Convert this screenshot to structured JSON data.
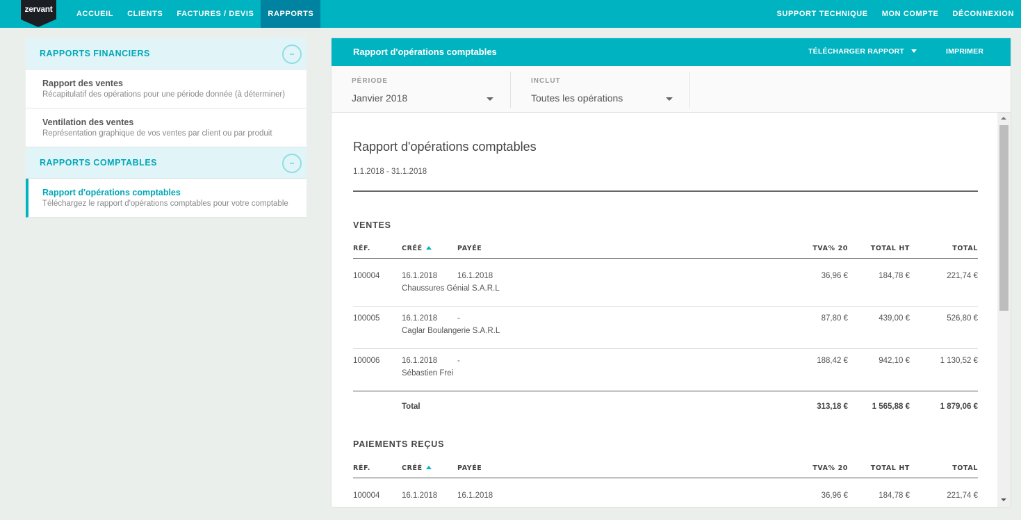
{
  "topnav": {
    "logo": "zervant",
    "left_items": [
      {
        "label": "ACCUEIL",
        "active": false
      },
      {
        "label": "CLIENTS",
        "active": false
      },
      {
        "label": "FACTURES / DEVIS",
        "active": false
      },
      {
        "label": "RAPPORTS",
        "active": true
      }
    ],
    "right_items": [
      {
        "label": "SUPPORT TECHNIQUE"
      },
      {
        "label": "MON COMPTE"
      },
      {
        "label": "DÉCONNEXION"
      }
    ]
  },
  "sidebar": {
    "groups": [
      {
        "title": "RAPPORTS FINANCIERS",
        "collapse_icon": "minus-circle-icon",
        "items": [
          {
            "title": "Rapport des ventes",
            "description": "Récapitulatif des opérations pour une période donnée (à déterminer)",
            "active": false
          },
          {
            "title": "Ventilation des ventes",
            "description": "Représentation graphique de vos ventes par client ou par produit",
            "active": false
          }
        ]
      },
      {
        "title": "RAPPORTS COMPTABLES",
        "collapse_icon": "minus-circle-icon",
        "items": [
          {
            "title": "Rapport d'opérations comptables",
            "description": "Téléchargez le rapport d'opérations comptables pour votre comptable",
            "active": true
          }
        ]
      }
    ]
  },
  "panel": {
    "title": "Rapport d'opérations comptables",
    "download_label": "TÉLÉCHARGER RAPPORT",
    "print_label": "IMPRIMER",
    "filters": {
      "period": {
        "label": "PÉRIODE",
        "value": "Janvier 2018"
      },
      "includes": {
        "label": "INCLUT",
        "value": "Toutes les opérations"
      }
    }
  },
  "report": {
    "title": "Rapport d'opérations comptables",
    "date_range": "1.1.2018 - 31.1.2018",
    "columns": {
      "ref": "RÉF.",
      "created": "CRÉÉ",
      "paid": "PAYÉE",
      "vat": "TVA% 20",
      "total_ht": "TOTAL HT",
      "total": "TOTAL"
    },
    "sales": {
      "title": "VENTES",
      "rows": [
        {
          "ref": "100004",
          "created": "16.1.2018",
          "paid": "16.1.2018",
          "client": "Chaussures Génial S.A.R.L",
          "vat": "36,96 €",
          "total_ht": "184,78 €",
          "total": "221,74 €"
        },
        {
          "ref": "100005",
          "created": "16.1.2018",
          "paid": "-",
          "client": "Caglar Boulangerie S.A.R.L",
          "vat": "87,80 €",
          "total_ht": "439,00 €",
          "total": "526,80 €"
        },
        {
          "ref": "100006",
          "created": "16.1.2018",
          "paid": "-",
          "client": "Sébastien Frei",
          "vat": "188,42 €",
          "total_ht": "942,10 €",
          "total": "1 130,52 €"
        }
      ],
      "totals": {
        "label": "Total",
        "vat": "313,18 €",
        "total_ht": "1 565,88 €",
        "total": "1 879,06 €"
      }
    },
    "payments": {
      "title": "PAIEMENTS REÇUS",
      "rows": [
        {
          "ref": "100004",
          "created": "16.1.2018",
          "paid": "16.1.2018",
          "vat": "36,96 €",
          "total_ht": "184,78 €",
          "total": "221,74 €"
        }
      ]
    }
  }
}
